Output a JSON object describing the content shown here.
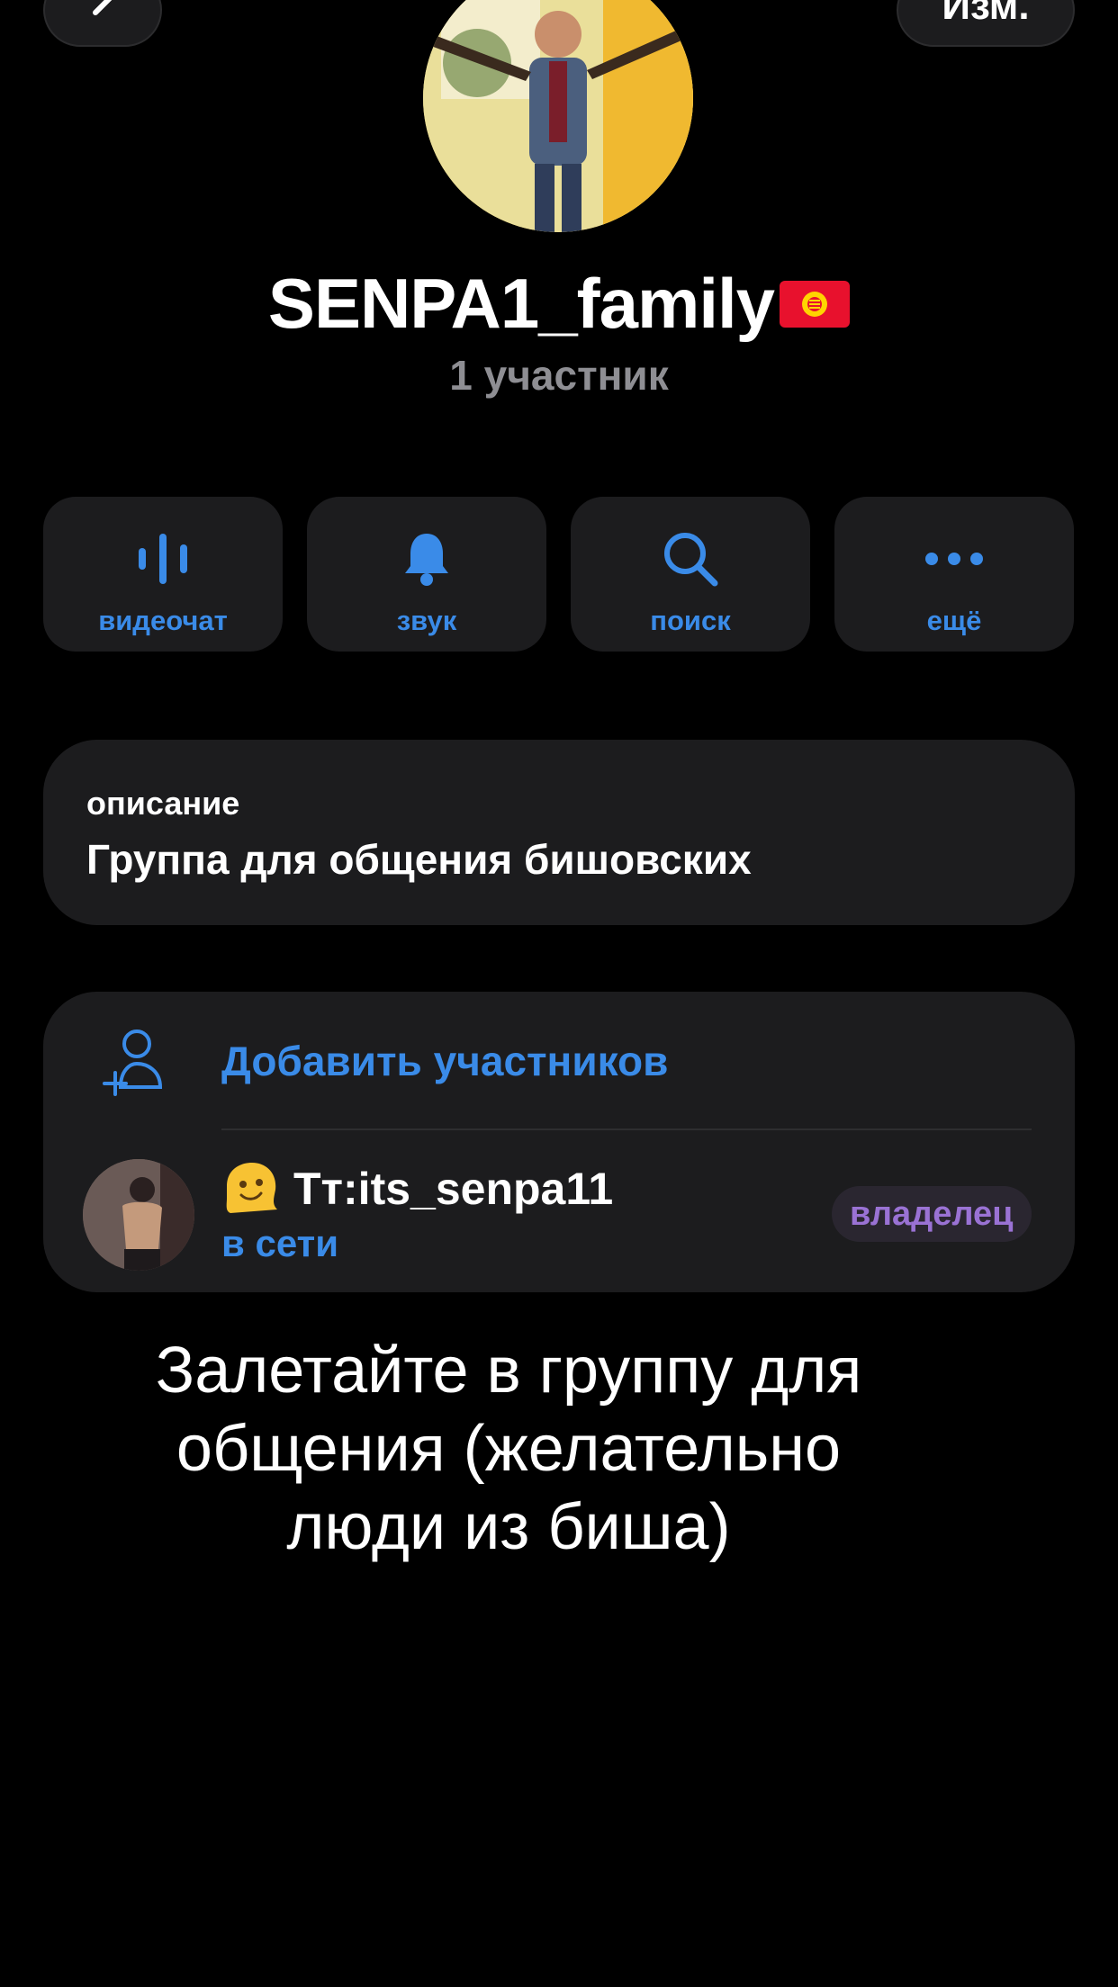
{
  "header": {
    "edit_label": "Изм.",
    "group_name": "SENPA1_family",
    "member_count": "1 участник"
  },
  "actions": [
    {
      "label": "видеочат",
      "icon": "voice-chat-icon"
    },
    {
      "label": "звук",
      "icon": "bell-icon"
    },
    {
      "label": "поиск",
      "icon": "search-icon"
    },
    {
      "label": "ещё",
      "icon": "more-dots-icon"
    }
  ],
  "description": {
    "label": "описание",
    "text": "Группа для общения бишовских"
  },
  "members": {
    "add_label": "Добавить участников",
    "list": [
      {
        "name": "Тт:its_senpa11",
        "status": "в сети",
        "role": "владелец",
        "emoji": "melting-face"
      }
    ]
  },
  "caption": {
    "lines": [
      "Залетайте в группу для",
      "общения (желательно",
      "люди из биша)"
    ]
  },
  "colors": {
    "accent": "#3a8be8",
    "card": "#1c1c1e",
    "muted": "#8e8e93",
    "owner_badge_text": "#9a72d4"
  }
}
